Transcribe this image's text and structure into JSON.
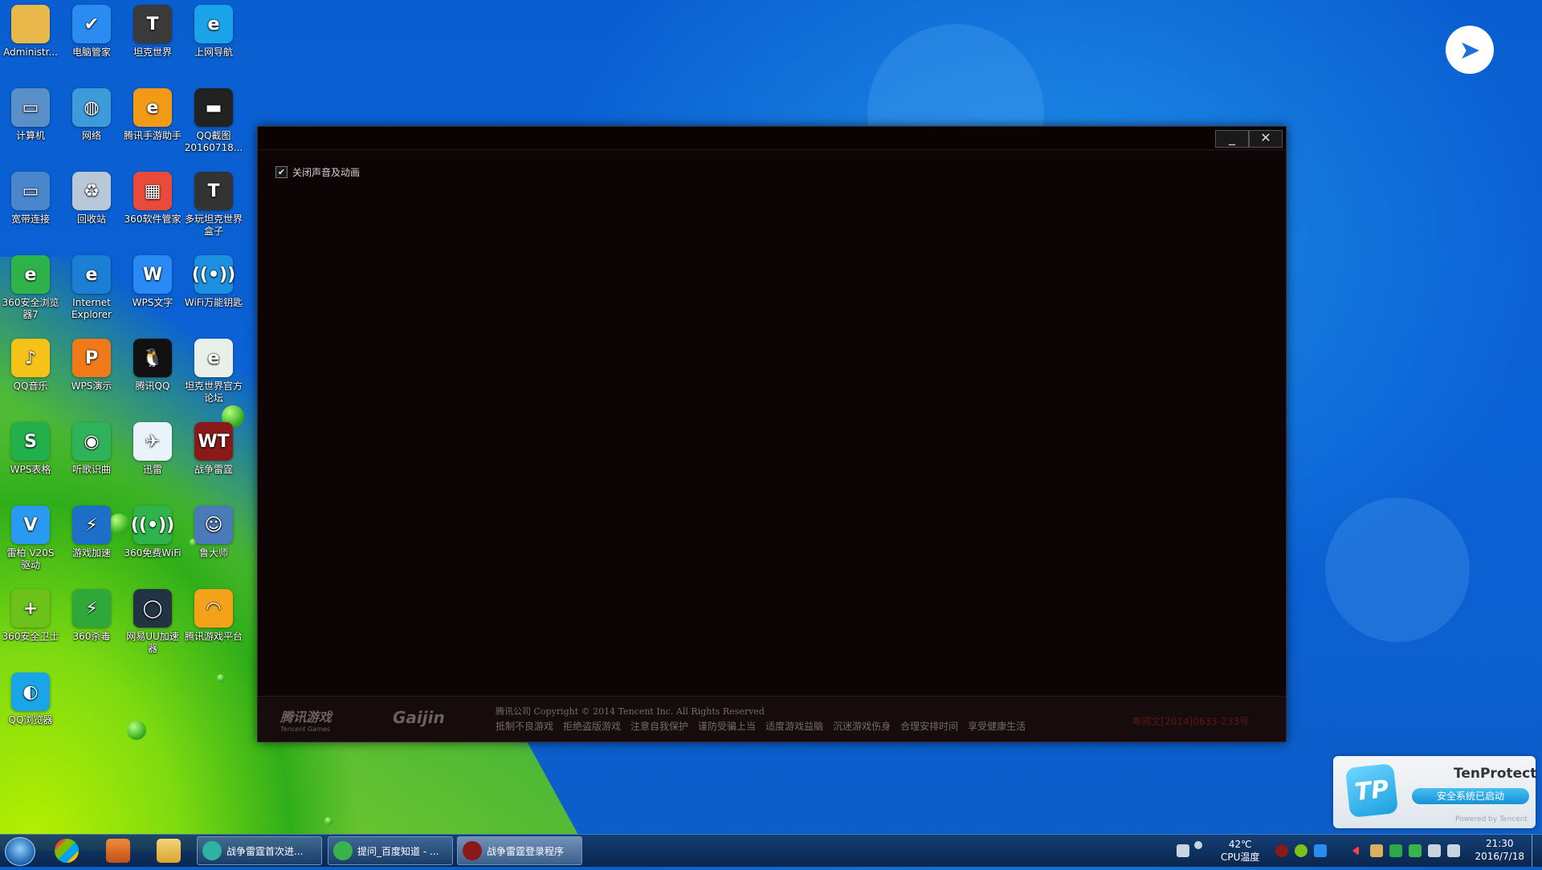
{
  "desktop": {
    "icons": [
      {
        "label": "Administr...",
        "icon": "folder-icon",
        "color": "#e8b84a",
        "glyph": ""
      },
      {
        "label": "电脑管家",
        "icon": "shield-icon",
        "color": "#2a8cf0",
        "glyph": "✔"
      },
      {
        "label": "坦克世界",
        "icon": "tank-game-icon",
        "color": "#3a3a3a",
        "glyph": "T"
      },
      {
        "label": "上网导航",
        "icon": "ie-icon",
        "color": "#1aa3e8",
        "glyph": "e"
      },
      {
        "label": "计算机",
        "icon": "computer-icon",
        "color": "#5a8fc8",
        "glyph": "▭"
      },
      {
        "label": "网络",
        "icon": "network-icon",
        "color": "#3c9bd8",
        "glyph": "◍"
      },
      {
        "label": "腾讯手游助手",
        "icon": "mobile-game-icon",
        "color": "#f29a16",
        "glyph": "e"
      },
      {
        "label": "QQ截图\n20160718...",
        "icon": "screenshot-icon",
        "color": "#222222",
        "glyph": "▬"
      },
      {
        "label": "宽带连接",
        "icon": "broadband-icon",
        "color": "#4a86cc",
        "glyph": "▭"
      },
      {
        "label": "回收站",
        "icon": "recycle-bin-icon",
        "color": "#b8c8d8",
        "glyph": "♻"
      },
      {
        "label": "360软件管家",
        "icon": "software-manager-icon",
        "color": "#e94a3a",
        "glyph": "▦"
      },
      {
        "label": "多玩坦克世界\n盒子",
        "icon": "tank-box-icon",
        "color": "#333333",
        "glyph": "T"
      },
      {
        "label": "360安全浏览\n器7",
        "icon": "360-browser-icon",
        "color": "#2db34a",
        "glyph": "e"
      },
      {
        "label": "Internet\nExplorer",
        "icon": "internet-explorer-icon",
        "color": "#1c7fd6",
        "glyph": "e"
      },
      {
        "label": "WPS文字",
        "icon": "wps-writer-icon",
        "color": "#2a8af5",
        "glyph": "W"
      },
      {
        "label": "WiFi万能钥匙",
        "icon": "wifi-key-icon",
        "color": "#1e90e0",
        "glyph": "((•))"
      },
      {
        "label": "QQ音乐",
        "icon": "qq-music-icon",
        "color": "#f5c21a",
        "glyph": "♪"
      },
      {
        "label": "WPS演示",
        "icon": "wps-presentation-icon",
        "color": "#f07a1a",
        "glyph": "P"
      },
      {
        "label": "腾讯QQ",
        "icon": "qq-penguin-icon",
        "color": "#111111",
        "glyph": "🐧"
      },
      {
        "label": "坦克世界官方\n论坛",
        "icon": "forum-icon",
        "color": "#e9efe9",
        "glyph": "e"
      },
      {
        "label": "WPS表格",
        "icon": "wps-spreadsheet-icon",
        "color": "#22b04a",
        "glyph": "S"
      },
      {
        "label": "听歌识曲",
        "icon": "song-recognition-icon",
        "color": "#2fb35a",
        "glyph": "◉"
      },
      {
        "label": "迅雷",
        "icon": "xunlei-icon",
        "color": "#eaf2fb",
        "glyph": "✈"
      },
      {
        "label": "战争雷霆",
        "icon": "war-thunder-icon",
        "color": "#8a1a1a",
        "glyph": "WT"
      },
      {
        "label": "雷柏 V20S\n驱动",
        "icon": "rapoo-driver-icon",
        "color": "#2a9af0",
        "glyph": "V"
      },
      {
        "label": "游戏加速",
        "icon": "game-accelerator-icon",
        "color": "#1e6fc8",
        "glyph": "⚡"
      },
      {
        "label": "360免费WiFi",
        "icon": "360-wifi-icon",
        "color": "#2fb34a",
        "glyph": "((•))"
      },
      {
        "label": "鲁大师",
        "icon": "ludashi-icon",
        "color": "#4a7ab8",
        "glyph": "☺"
      },
      {
        "label": "360安全卫士",
        "icon": "360-security-icon",
        "color": "#6cc21a",
        "glyph": "+"
      },
      {
        "label": "360杀毒",
        "icon": "360-antivirus-icon",
        "color": "#2fa83a",
        "glyph": "⚡"
      },
      {
        "label": "网易UU加速\n器",
        "icon": "uu-accelerator-icon",
        "color": "#223344",
        "glyph": "◯"
      },
      {
        "label": "腾讯游戏平台",
        "icon": "tencent-game-platform-icon",
        "color": "#f3a21a",
        "glyph": "◠"
      },
      {
        "label": "QQ浏览器",
        "icon": "qq-browser-icon",
        "color": "#1aa5e8",
        "glyph": "◐"
      }
    ]
  },
  "window": {
    "minimize_label": "_",
    "close_label": "✕",
    "checkbox": {
      "label": "关闭声音及动画",
      "checked": true,
      "mark": "✔"
    },
    "footer": {
      "logo_tencent": "腾讯游戏",
      "logo_tencent_sub": "Tencent Games",
      "logo_gaijin": "Gaijin",
      "copyright": "腾讯公司 Copyright © 2014 Tencent Inc. All Rights Reserved",
      "links": [
        "抵制不良游戏",
        "拒绝盗版游戏",
        "注意自我保护",
        "谨防受骗上当",
        "适度游戏益脑",
        "沉迷游戏伤身",
        "合理安排时间",
        "享受健康生活"
      ],
      "license": "粤网文[2014]0633-233号"
    }
  },
  "tenprotect": {
    "logo": "TP",
    "title": "TenProtect",
    "status": "安全系统已启动",
    "powered": "Powered by Tencent"
  },
  "taskbar": {
    "tasks": [
      {
        "label": "战争雷霆首次进...",
        "icon": "browser-task-icon",
        "color": "#2db3a0",
        "active": false
      },
      {
        "label": "提问_百度知道 - ...",
        "icon": "360-browser-task-icon",
        "color": "#3ab34a",
        "active": false
      },
      {
        "label": "战争雷霆登录程序",
        "icon": "war-thunder-task-icon",
        "color": "#8a1a1a",
        "active": true
      }
    ],
    "temperature": "42℃",
    "temperature_label": "CPU温度",
    "time": "21:30",
    "date": "2016/7/18"
  }
}
